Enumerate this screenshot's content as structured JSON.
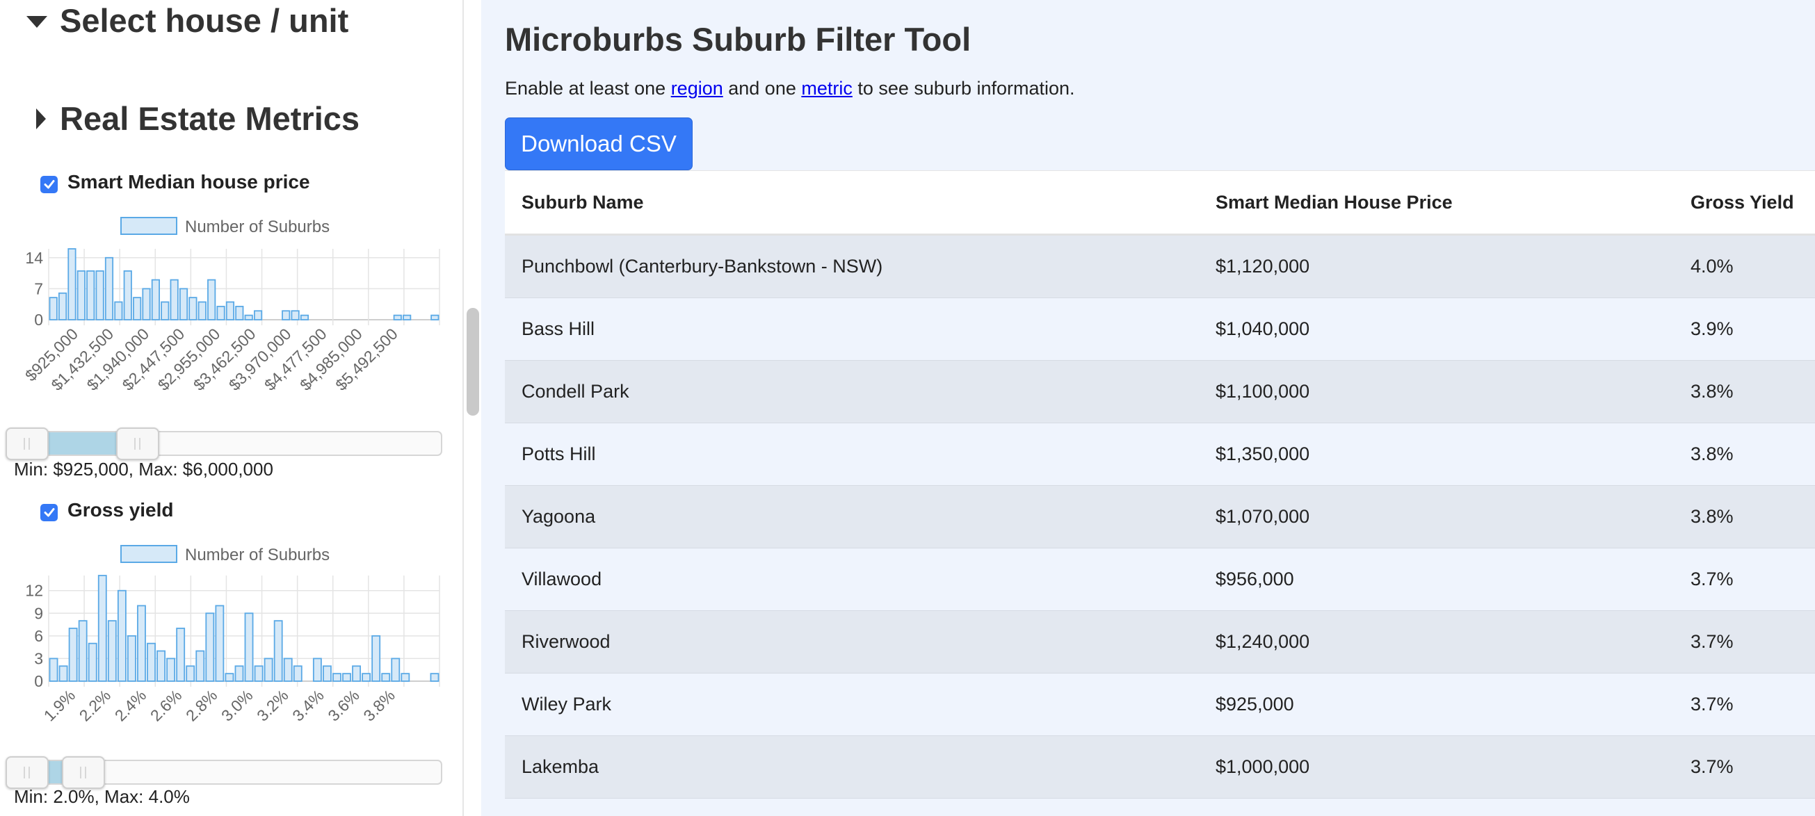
{
  "sidebar": {
    "select_heading": "Select house / unit",
    "metrics_heading": "Real Estate Metrics",
    "metrics": [
      {
        "label": "Smart Median house price",
        "checked": true,
        "chart_data": {
          "type": "bar",
          "legend": "Number of Suburbs",
          "legend_position": "top",
          "grid": true,
          "ylim": [
            0,
            16
          ],
          "yticks": [
            "0",
            "7",
            "14"
          ],
          "xticks": [
            "$925,000",
            "$1,432,500",
            "$1,940,000",
            "$2,447,500",
            "$2,955,000",
            "$3,462,500",
            "$3,970,000",
            "$4,477,500",
            "$4,985,000",
            "$5,492,500"
          ],
          "values": [
            5,
            6,
            16,
            11,
            11,
            11,
            14,
            4,
            11,
            5,
            7,
            9,
            4,
            9,
            7,
            5,
            4,
            9,
            3,
            4,
            3,
            1,
            2,
            0,
            0,
            2,
            2,
            1,
            0,
            0,
            0,
            0,
            0,
            0,
            0,
            0,
            0,
            1,
            1,
            0,
            0,
            1
          ]
        },
        "slider": {
          "min_fraction": 0.0,
          "max_fraction": 0.2,
          "text": "Min: $925,000, Max: $6,000,000"
        }
      },
      {
        "label": "Gross yield",
        "checked": true,
        "chart_data": {
          "type": "bar",
          "legend": "Number of Suburbs",
          "legend_position": "top",
          "grid": true,
          "ylim": [
            0,
            14
          ],
          "yticks": [
            "0",
            "3",
            "6",
            "9",
            "12"
          ],
          "xticks": [
            "1.9%",
            "2.2%",
            "2.4%",
            "2.6%",
            "2.8%",
            "3.0%",
            "3.2%",
            "3.4%",
            "3.6%",
            "3.8%"
          ],
          "values": [
            3,
            2,
            7,
            8,
            5,
            14,
            8,
            12,
            6,
            10,
            5,
            4,
            3,
            7,
            2,
            4,
            9,
            10,
            1,
            2,
            9,
            2,
            3,
            8,
            3,
            2,
            0,
            3,
            2,
            1,
            1,
            2,
            1,
            6,
            1,
            3,
            1,
            0,
            0,
            1
          ]
        },
        "slider": {
          "min_fraction": 0.0,
          "max_fraction": 0.07,
          "text": "Min: 2.0%, Max: 4.0%"
        }
      }
    ]
  },
  "main": {
    "title": "Microburbs Suburb Filter Tool",
    "instructions": {
      "prefix": "Enable at least one ",
      "region_link": "region",
      "middle": " and one ",
      "metric_link": "metric",
      "suffix": " to see suburb information."
    },
    "download_label": "Download CSV",
    "table": {
      "headers": [
        "Suburb Name",
        "Smart Median House Price",
        "Gross Yield"
      ],
      "rows": [
        [
          "Punchbowl (Canterbury-Bankstown - NSW)",
          "$1,120,000",
          "4.0%"
        ],
        [
          "Bass Hill",
          "$1,040,000",
          "3.9%"
        ],
        [
          "Condell Park",
          "$1,100,000",
          "3.8%"
        ],
        [
          "Potts Hill",
          "$1,350,000",
          "3.8%"
        ],
        [
          "Yagoona",
          "$1,070,000",
          "3.8%"
        ],
        [
          "Villawood",
          "$956,000",
          "3.7%"
        ],
        [
          "Riverwood",
          "$1,240,000",
          "3.7%"
        ],
        [
          "Wiley Park",
          "$925,000",
          "3.7%"
        ],
        [
          "Lakemba",
          "$1,000,000",
          "3.7%"
        ]
      ]
    }
  },
  "colors": {
    "accent": "#3478f6",
    "bar_fill": "#d6e9f8",
    "bar_stroke": "#5aa9e6",
    "slider_range": "#aed5e6",
    "main_bg": "#eff4fd"
  }
}
